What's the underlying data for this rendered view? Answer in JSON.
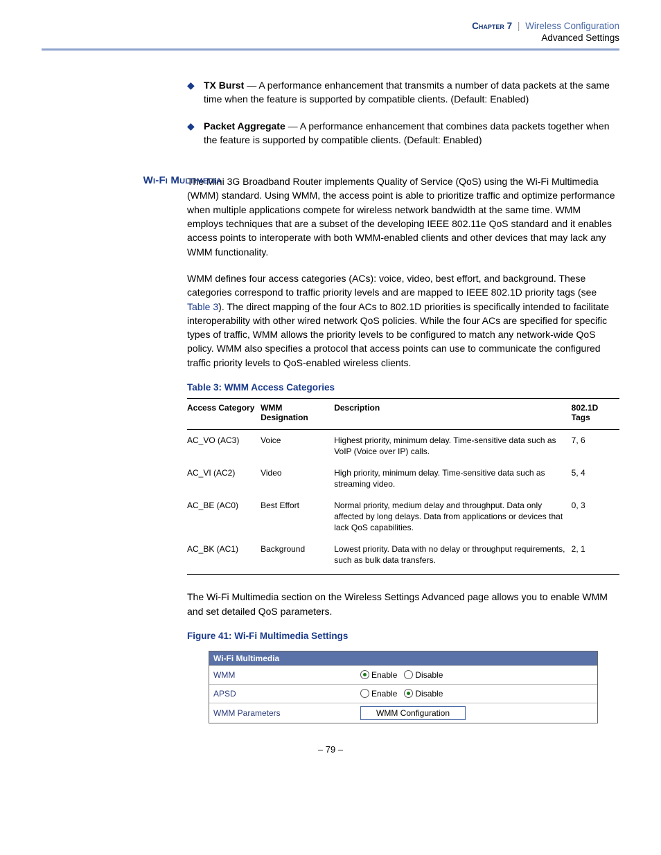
{
  "header": {
    "chapter": "Chapter 7",
    "section": "Wireless Configuration",
    "subsection": "Advanced Settings"
  },
  "bullets": {
    "tx_burst": {
      "term": "TX Burst",
      "text": " — A performance enhancement that transmits a number of data packets at the same time when the feature is supported by compatible clients. (Default: Enabled)"
    },
    "packet_aggregate": {
      "term": "Packet Aggregate",
      "text": " — A performance enhancement that combines data packets together when the feature is supported by compatible clients. (Default: Enabled)"
    }
  },
  "wifi_section": {
    "heading": "Wi-Fi Multimedia",
    "para1": "The Mini 3G Broadband Router implements Quality of Service (QoS) using the Wi-Fi Multimedia (WMM) standard. Using WMM, the access point is able to prioritize traffic and optimize performance when multiple applications compete for wireless network bandwidth at the same time. WMM employs techniques that are a subset of the developing IEEE 802.11e QoS standard and it enables access points to interoperate with both WMM-enabled clients and other devices that may lack any WMM functionality.",
    "para2a": "WMM defines four access categories (ACs): voice, video, best effort, and background. These categories correspond to traffic priority levels and are mapped to IEEE 802.1D priority tags (see ",
    "para2link": "Table 3",
    "para2b": "). The direct mapping of the four ACs to 802.1D priorities is specifically intended to facilitate interoperability with other wired network QoS policies. While the four ACs are specified for specific types of traffic, WMM allows the priority levels to be configured to match any network-wide QoS policy. WMM also specifies a protocol that access points can use to communicate the configured traffic priority levels to QoS-enabled wireless clients."
  },
  "table": {
    "title": "Table 3: WMM Access Categories",
    "headers": {
      "ac": "Access Category",
      "wmm": "WMM Designation",
      "desc": "Description",
      "tags": "802.1D Tags"
    },
    "rows": [
      {
        "ac": "AC_VO (AC3)",
        "wmm": "Voice",
        "desc": "Highest priority, minimum delay. Time-sensitive data such as VoIP (Voice over IP) calls.",
        "tags": "7, 6"
      },
      {
        "ac": "AC_VI (AC2)",
        "wmm": "Video",
        "desc": "High priority, minimum delay. Time-sensitive data such as streaming video.",
        "tags": "5, 4"
      },
      {
        "ac": "AC_BE (AC0)",
        "wmm": "Best Effort",
        "desc": "Normal priority, medium delay and throughput. Data only affected by long delays. Data from applications or devices that lack QoS capabilities.",
        "tags": "0, 3"
      },
      {
        "ac": "AC_BK (AC1)",
        "wmm": "Background",
        "desc": "Lowest priority. Data with no delay or throughput requirements, such as bulk data transfers.",
        "tags": "2, 1"
      }
    ]
  },
  "outro_para": "The Wi-Fi Multimedia section on the Wireless Settings Advanced page allows you to enable WMM and set detailed QoS parameters.",
  "figure": {
    "title": "Figure 41:  Wi-Fi Multimedia Settings",
    "box_title": "Wi-Fi Multimedia",
    "rows": {
      "wmm_label": "WMM",
      "apsd_label": "APSD",
      "params_label": "WMM Parameters",
      "enable": "Enable",
      "disable": "Disable",
      "button": "WMM Configuration"
    },
    "wmm_selected": "enable",
    "apsd_selected": "disable"
  },
  "page_number": "–  79  –"
}
